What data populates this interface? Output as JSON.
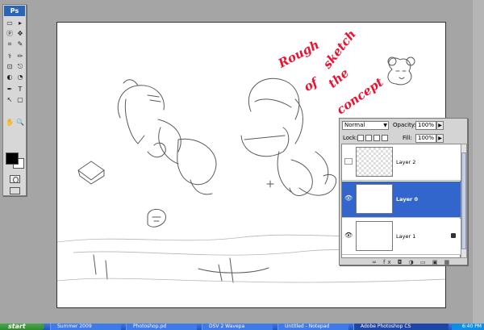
{
  "toolbox": {
    "logo": "Ps",
    "tools": [
      "▭",
      "▸",
      "ⓟ",
      "✥",
      "⌗",
      "✎",
      "⚕",
      "✏",
      "⊡",
      "⎋",
      "◐",
      "◔",
      "✒",
      "T",
      "↖",
      "▢",
      "✋",
      "🔍"
    ],
    "foreground_color": "#000000",
    "background_color": "#ffffff"
  },
  "sketch_note": {
    "lines": [
      "Rough",
      "sketch",
      "of",
      "the",
      "concept"
    ],
    "color": "#ee1030"
  },
  "layers_panel": {
    "blend_mode": "Normal",
    "opacity_label": "Opacity:",
    "opacity_value": "100%",
    "lock_label": "Lock:",
    "fill_label": "Fill:",
    "fill_value": "100%",
    "layers": [
      {
        "name": "Layer 2",
        "visible": false,
        "selected": false
      },
      {
        "name": "Layer 0",
        "visible": true,
        "selected": true
      },
      {
        "name": "Layer 1",
        "visible": true,
        "selected": false,
        "locked": true
      }
    ],
    "footer_icons": "∞ fx ◘ ◑ ▭ ▣ ▦"
  },
  "taskbar": {
    "start_label": "start",
    "tasks": [
      {
        "label": "Summer 2009",
        "active": false
      },
      {
        "label": "Photoshop.pd",
        "active": false
      },
      {
        "label": "DSV 2 Wavepa",
        "active": false
      },
      {
        "label": "Untitled - Notepad",
        "active": false
      },
      {
        "label": "Adobe Photoshop CS",
        "active": true
      }
    ],
    "clock": "6:40 PM"
  }
}
